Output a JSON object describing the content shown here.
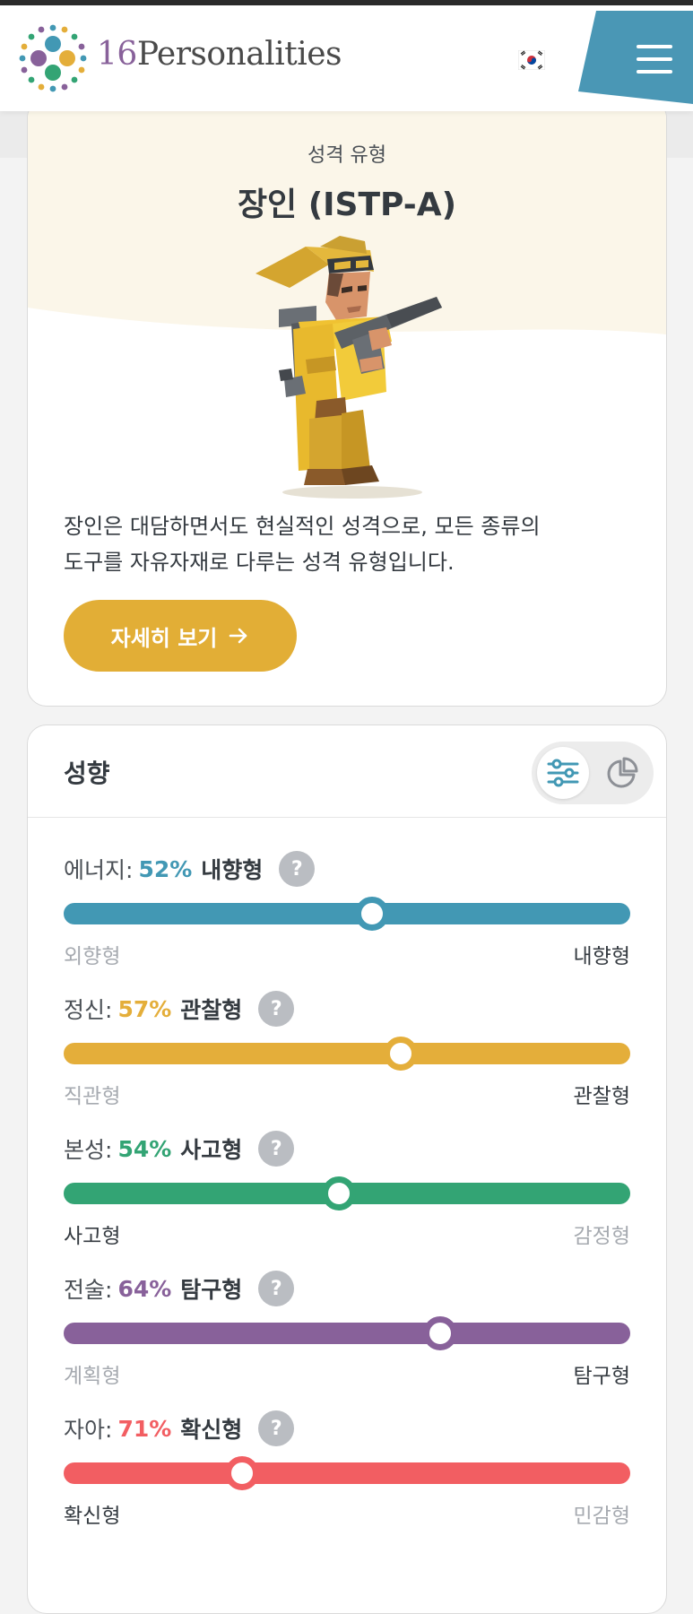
{
  "header": {
    "brand_number": "16",
    "brand_word": "Personalities",
    "language_flag": "korea-flag-icon",
    "menu_icon": "hamburger-menu-icon"
  },
  "hero": {
    "type_label": "성격 유형",
    "type_name": "장인 (ISTP-A)",
    "illustration": "virtuoso-character-with-tools",
    "description_line1": "장인은 대담하면서도 현실적인 성격으로, 모든 종류의",
    "description_line2": "도구를 자유자재로 다루는 성격 유형입니다.",
    "more_button": "자세히 보기",
    "more_button_icon": "arrow-right-icon",
    "bg_color": "#fbf6e9",
    "button_color": "#e2ae36"
  },
  "traits": {
    "title": "성향",
    "view_toggle": {
      "active": "sliders-icon",
      "inactive": "pie-chart-icon"
    },
    "help_glyph": "?",
    "items": [
      {
        "key": "energy",
        "label": "에너지:",
        "pct_text": "52%",
        "type": "내향형",
        "left": "외향형",
        "right": "내향형",
        "position": 0.545,
        "dominant": "right",
        "color": "#4298b4"
      },
      {
        "key": "mind",
        "label": "정신:",
        "pct_text": "57%",
        "type": "관찰형",
        "left": "직관형",
        "right": "관찰형",
        "position": 0.595,
        "dominant": "right",
        "color": "#e4ae3a"
      },
      {
        "key": "nature",
        "label": "본성:",
        "pct_text": "54%",
        "type": "사고형",
        "left": "사고형",
        "right": "감정형",
        "position": 0.485,
        "dominant": "left",
        "color": "#33a474"
      },
      {
        "key": "tactics",
        "label": "전술:",
        "pct_text": "64%",
        "type": "탐구형",
        "left": "계획형",
        "right": "탐구형",
        "position": 0.665,
        "dominant": "right",
        "color": "#88619a"
      },
      {
        "key": "identity",
        "label": "자아:",
        "pct_text": "71%",
        "type": "확신형",
        "left": "확신형",
        "right": "민감형",
        "position": 0.315,
        "dominant": "left",
        "color": "#f25e62"
      }
    ]
  }
}
